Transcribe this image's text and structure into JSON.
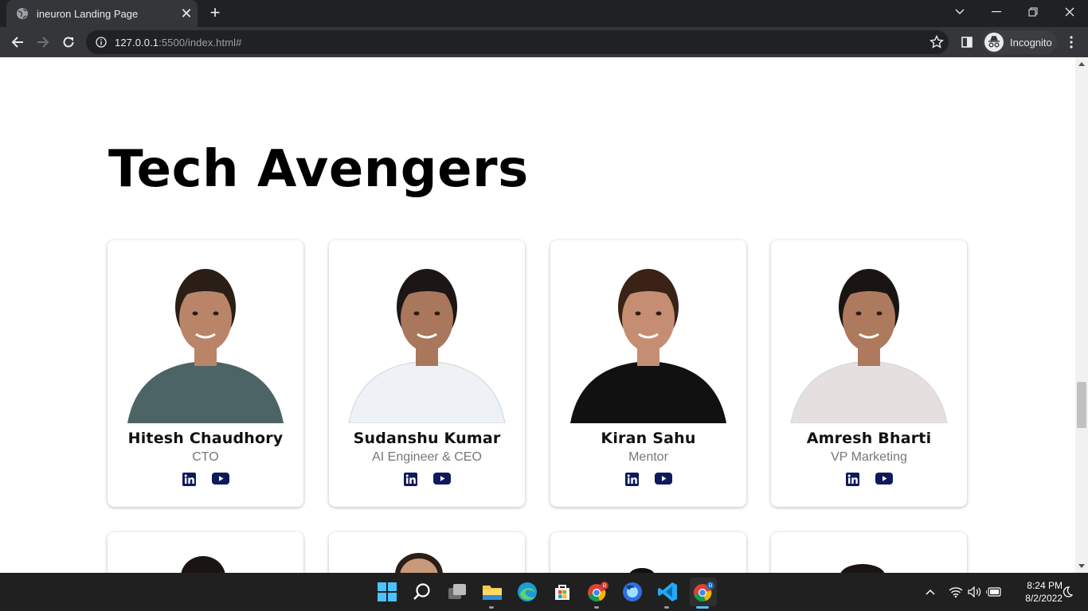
{
  "browser": {
    "tab_title": "ineuron Landing Page",
    "url_host": "127.0.0.1",
    "url_rest": ":5500/index.html#",
    "incognito_label": "Incognito"
  },
  "page": {
    "heading": "Tech Avengers",
    "team": [
      {
        "name": "Hitesh Chaudhory",
        "role": "CTO",
        "shirt": "#4d6466",
        "hair": "#2a1e17"
      },
      {
        "name": "Sudanshu Kumar",
        "role": "AI Engineer & CEO",
        "shirt": "#eef2f6",
        "hair": "#1c1714"
      },
      {
        "name": "Kiran Sahu",
        "role": "Mentor",
        "shirt": "#111111",
        "hair": "#3b2216"
      },
      {
        "name": "Amresh Bharti",
        "role": "VP Marketing",
        "shirt": "#e6dfe0",
        "hair": "#1a1513"
      }
    ],
    "social_icons": [
      "linkedin-icon",
      "youtube-icon"
    ]
  },
  "colors": {
    "social": "#0f1a5c",
    "browser_dark": "#202124",
    "toolbar": "#35363a"
  },
  "taskbar": {
    "apps": [
      "windows-start-icon",
      "search-icon",
      "task-view-icon",
      "file-explorer-icon",
      "edge-icon",
      "store-icon",
      "chrome-icon",
      "firefox-icon",
      "vscode-icon",
      "chrome-incognito-icon"
    ],
    "time": "8:24 PM",
    "date": "8/2/2022"
  }
}
